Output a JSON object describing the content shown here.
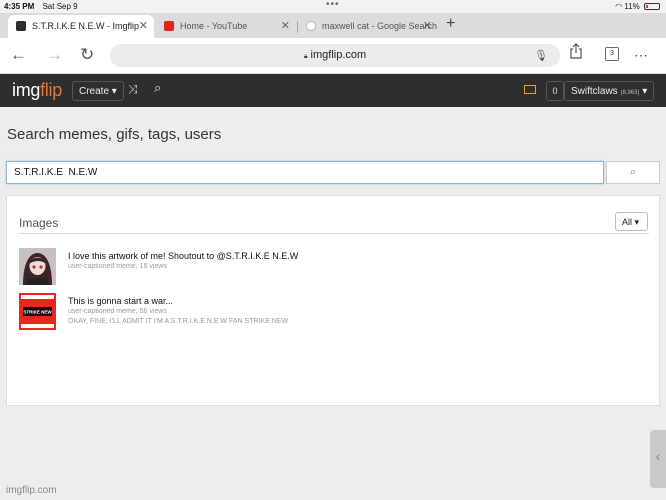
{
  "status": {
    "time": "4:35 PM",
    "date": "Sat Sep 9",
    "battery": "11%"
  },
  "tabs": [
    {
      "title": "S.T.R.I.K.E N.E.W - Imgflip",
      "active": true
    },
    {
      "title": "Home - YouTube",
      "active": false
    },
    {
      "title": "maxwell cat - Google Search",
      "active": false
    }
  ],
  "browser": {
    "url": "imgflip.com",
    "tab_count": "3"
  },
  "site": {
    "logo_a": "img",
    "logo_b": "flip",
    "create_label": "Create",
    "notif_count": "0",
    "username": "Swiftclaws",
    "user_points": "(8,963)"
  },
  "main": {
    "heading": "Search memes, gifs, tags, users",
    "search_value": "S.T.R.I.K.E  N.E.W",
    "panel_title": "Images",
    "filter_value": "All",
    "results": [
      {
        "title": "I love this artwork of me! Shoutout to @S.T.R.I.K.E N.E.W",
        "meta": "user-captioned meme, 16 views",
        "caption": ""
      },
      {
        "title": "This is gonna start a war...",
        "meta": "user-captioned meme, 56 views",
        "caption": "OKAY, FINE, I'LL ADMIT IT I'M A S.T.R.I.K.E N.E.W FAN STRIKE NEW",
        "thumb_text": "STRIKE NEW"
      }
    ]
  },
  "footer": "imgflip.com",
  "colors": {
    "site_bar": "#2e2e2e",
    "accent": "#e0763a",
    "youtube": "#e62117"
  }
}
